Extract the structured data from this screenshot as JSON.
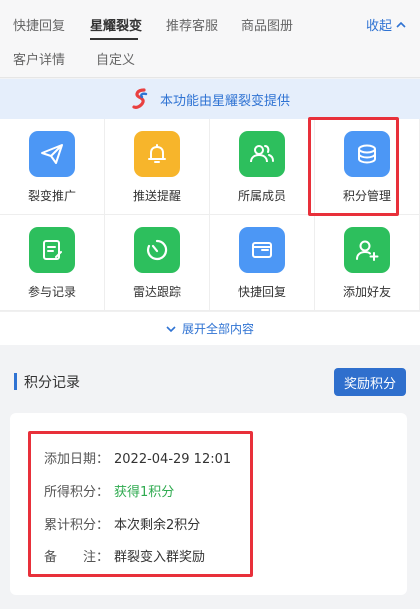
{
  "tabs": [
    {
      "label": "快捷回复"
    },
    {
      "label": "星耀裂变"
    },
    {
      "label": "推荐客服"
    },
    {
      "label": "商品图册"
    },
    {
      "label": "客户详情"
    },
    {
      "label": "自定义"
    }
  ],
  "collapse_label": "收起",
  "banner": {
    "text": "本功能由星耀裂变提供"
  },
  "grid": [
    {
      "label": "裂变推广",
      "icon": "paper-plane-icon",
      "color": "#4c97f5"
    },
    {
      "label": "推送提醒",
      "icon": "bell-icon",
      "color": "#f7b52b"
    },
    {
      "label": "所属成员",
      "icon": "users-icon",
      "color": "#2dbf5d"
    },
    {
      "label": "积分管理",
      "icon": "coins-icon",
      "color": "#4c97f5"
    },
    {
      "label": "参与记录",
      "icon": "record-icon",
      "color": "#2dbf5d"
    },
    {
      "label": "雷达跟踪",
      "icon": "radar-icon",
      "color": "#2dbf5d"
    },
    {
      "label": "快捷回复",
      "icon": "envelope-icon",
      "color": "#4c97f5"
    },
    {
      "label": "添加好友",
      "icon": "add-user-icon",
      "color": "#2dbf5d"
    }
  ],
  "expand_label": "展开全部内容",
  "section": {
    "title": "积分记录",
    "reward_button": "奖励积分"
  },
  "record": {
    "date_key": "添加日期：",
    "date_val": "2022-04-29 12:01",
    "points_key": "所得积分：",
    "points_val": "获得1积分",
    "total_key": "累计积分：",
    "total_val": "本次剩余2积分",
    "note_key": "备　　注：",
    "note_val": "群裂变入群奖励"
  },
  "colors": {
    "accent": "#2f73d3",
    "highlight": "#e8303a",
    "green_text": "#2eaa4f"
  }
}
